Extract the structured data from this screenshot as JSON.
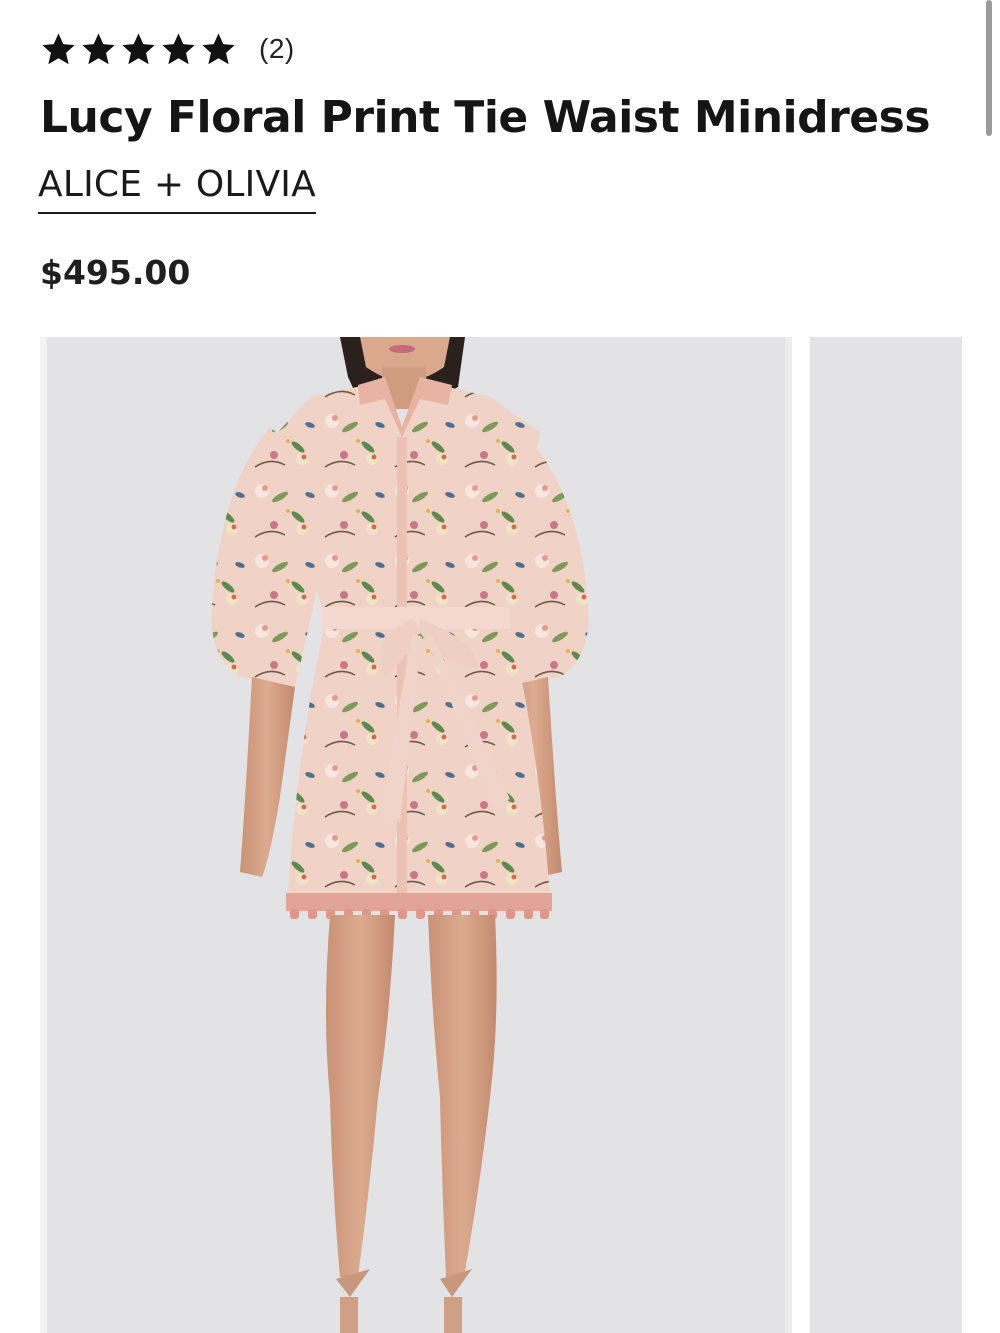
{
  "rating": {
    "stars": 5,
    "count_text": "(2)"
  },
  "product": {
    "title": "Lucy Floral Print Tie Waist Minidress",
    "brand": "ALICE + OLIVIA",
    "price": "$495.00"
  },
  "gallery": {
    "main_image_icon": "product-photo-dress",
    "next_image_icon": "product-photo-next"
  },
  "colors": {
    "text": "#1a1a1a",
    "image_bg": "#e3e3e5",
    "dress_base": "#f1d2c6",
    "trim": "#e2a497"
  }
}
